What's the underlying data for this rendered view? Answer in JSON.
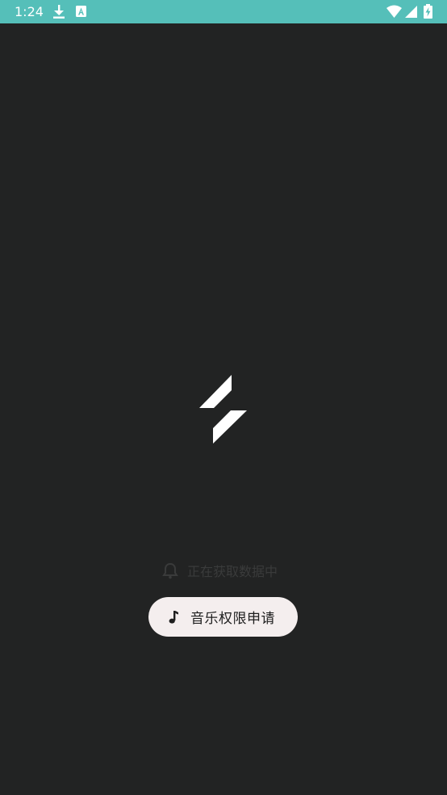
{
  "status_bar": {
    "time": "1:24",
    "color": "#55bfb9",
    "icons": [
      "download-icon",
      "a-icon",
      "wifi-icon",
      "signal-icon",
      "battery-icon"
    ]
  },
  "main": {
    "background": "#222323",
    "logo": "app-logo",
    "hint": {
      "icon": "bell-icon",
      "text": "正在获取数据中"
    },
    "permission_button": {
      "icon": "music-note-icon",
      "label": "音乐权限申请"
    }
  }
}
